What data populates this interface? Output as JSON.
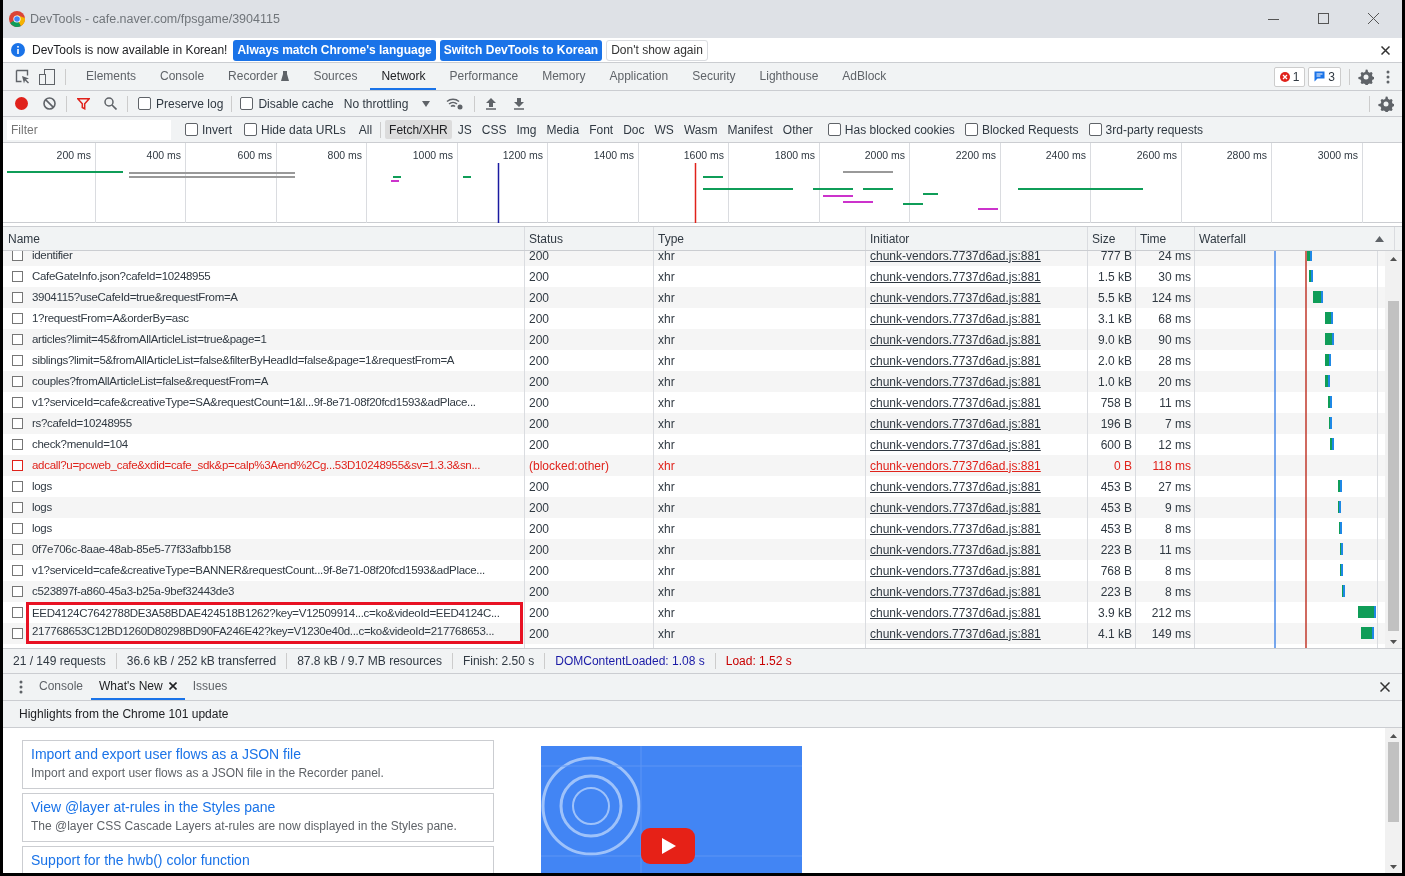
{
  "window": {
    "title": "DevTools - cafe.naver.com/fpsgame/3904115"
  },
  "infobar": {
    "message": "DevTools is now available in Korean!",
    "buttons": [
      {
        "label": "Always match Chrome's language",
        "kind": "primary"
      },
      {
        "label": "Switch DevTools to Korean",
        "kind": "primary"
      },
      {
        "label": "Don't show again",
        "kind": "secondary"
      }
    ]
  },
  "panel_tabs": [
    {
      "label": "Elements",
      "selected": false
    },
    {
      "label": "Console",
      "selected": false
    },
    {
      "label": "Recorder",
      "selected": false,
      "experimental": true
    },
    {
      "label": "Sources",
      "selected": false
    },
    {
      "label": "Network",
      "selected": true
    },
    {
      "label": "Performance",
      "selected": false
    },
    {
      "label": "Memory",
      "selected": false
    },
    {
      "label": "Application",
      "selected": false
    },
    {
      "label": "Security",
      "selected": false
    },
    {
      "label": "Lighthouse",
      "selected": false
    },
    {
      "label": "AdBlock",
      "selected": false
    }
  ],
  "counters": {
    "errors": "1",
    "messages": "3"
  },
  "toolbar": {
    "recording": true,
    "preserve_log": false,
    "disable_cache": false,
    "throttling": "No throttling",
    "preserve_log_label": "Preserve log",
    "disable_cache_label": "Disable cache"
  },
  "filter": {
    "placeholder": "Filter",
    "options": [
      {
        "label": "Invert",
        "checked": false
      },
      {
        "label": "Hide data URLs",
        "checked": false
      }
    ],
    "types": [
      {
        "label": "All",
        "selected": false
      },
      {
        "label": "Fetch/XHR",
        "selected": true
      },
      {
        "label": "JS",
        "selected": false
      },
      {
        "label": "CSS",
        "selected": false
      },
      {
        "label": "Img",
        "selected": false
      },
      {
        "label": "Media",
        "selected": false
      },
      {
        "label": "Font",
        "selected": false
      },
      {
        "label": "Doc",
        "selected": false
      },
      {
        "label": "WS",
        "selected": false
      },
      {
        "label": "Wasm",
        "selected": false
      },
      {
        "label": "Manifest",
        "selected": false
      },
      {
        "label": "Other",
        "selected": false
      }
    ],
    "extra": [
      {
        "label": "Has blocked cookies",
        "checked": false
      },
      {
        "label": "Blocked Requests",
        "checked": false
      },
      {
        "label": "3rd-party requests",
        "checked": false
      }
    ]
  },
  "overview": {
    "ticks": [
      "200 ms",
      "400 ms",
      "600 ms",
      "800 ms",
      "1000 ms",
      "1200 ms",
      "1400 ms",
      "1600 ms",
      "1800 ms",
      "2000 ms",
      "2200 ms",
      "2400 ms",
      "2600 ms",
      "2800 ms",
      "3000 ms"
    ]
  },
  "table": {
    "columns": [
      "Name",
      "Status",
      "Type",
      "Initiator",
      "Size",
      "Time",
      "Waterfall"
    ],
    "rows": [
      {
        "name": "identifier",
        "status": "200",
        "type": "xhr",
        "initiator": "chunk-vendors.7737d6ad.js:881",
        "size": "777 B",
        "time": "24 ms",
        "blocked": false,
        "highlighted": false,
        "checked": false
      },
      {
        "name": "CafeGateInfo.json?cafeId=10248955",
        "status": "200",
        "type": "xhr",
        "initiator": "chunk-vendors.7737d6ad.js:881",
        "size": "1.5 kB",
        "time": "30 ms",
        "blocked": false,
        "highlighted": false,
        "checked": false
      },
      {
        "name": "3904115?useCafeId=true&requestFrom=A",
        "status": "200",
        "type": "xhr",
        "initiator": "chunk-vendors.7737d6ad.js:881",
        "size": "5.5 kB",
        "time": "124 ms",
        "blocked": false,
        "highlighted": false,
        "checked": false
      },
      {
        "name": "1?requestFrom=A&orderBy=asc",
        "status": "200",
        "type": "xhr",
        "initiator": "chunk-vendors.7737d6ad.js:881",
        "size": "3.1 kB",
        "time": "68 ms",
        "blocked": false,
        "highlighted": false,
        "checked": false
      },
      {
        "name": "articles?limit=45&fromAllArticleList=true&page=1",
        "status": "200",
        "type": "xhr",
        "initiator": "chunk-vendors.7737d6ad.js:881",
        "size": "9.0 kB",
        "time": "90 ms",
        "blocked": false,
        "highlighted": false,
        "checked": false
      },
      {
        "name": "siblings?limit=5&fromAllArticleList=false&filterByHeadId=false&page=1&requestFrom=A",
        "status": "200",
        "type": "xhr",
        "initiator": "chunk-vendors.7737d6ad.js:881",
        "size": "2.0 kB",
        "time": "28 ms",
        "blocked": false,
        "highlighted": false,
        "checked": false
      },
      {
        "name": "couples?fromAllArticleList=false&requestFrom=A",
        "status": "200",
        "type": "xhr",
        "initiator": "chunk-vendors.7737d6ad.js:881",
        "size": "1.0 kB",
        "time": "20 ms",
        "blocked": false,
        "highlighted": false,
        "checked": false
      },
      {
        "name": "v1?serviceId=cafe&creativeType=SA&requestCount=1&l...9f-8e71-08f20fcd1593&adPlace...",
        "status": "200",
        "type": "xhr",
        "initiator": "chunk-vendors.7737d6ad.js:881",
        "size": "758 B",
        "time": "11 ms",
        "blocked": false,
        "highlighted": false,
        "checked": false
      },
      {
        "name": "rs?cafeId=10248955",
        "status": "200",
        "type": "xhr",
        "initiator": "chunk-vendors.7737d6ad.js:881",
        "size": "196 B",
        "time": "7 ms",
        "blocked": false,
        "highlighted": false,
        "checked": false
      },
      {
        "name": "check?menuId=104",
        "status": "200",
        "type": "xhr",
        "initiator": "chunk-vendors.7737d6ad.js:881",
        "size": "600 B",
        "time": "12 ms",
        "blocked": false,
        "highlighted": false,
        "checked": false
      },
      {
        "name": "adcall?u=pcweb_cafe&xdid=cafe_sdk&p=calp%3Aend%2Cg...53D10248955&sv=1.3.3&sn...",
        "status": "(blocked:other)",
        "type": "xhr",
        "initiator": "chunk-vendors.7737d6ad.js:881",
        "size": "0 B",
        "time": "118 ms",
        "blocked": true,
        "highlighted": false,
        "checked": false
      },
      {
        "name": "logs",
        "status": "200",
        "type": "xhr",
        "initiator": "chunk-vendors.7737d6ad.js:881",
        "size": "453 B",
        "time": "27 ms",
        "blocked": false,
        "highlighted": false,
        "checked": false
      },
      {
        "name": "logs",
        "status": "200",
        "type": "xhr",
        "initiator": "chunk-vendors.7737d6ad.js:881",
        "size": "453 B",
        "time": "9 ms",
        "blocked": false,
        "highlighted": false,
        "checked": false
      },
      {
        "name": "logs",
        "status": "200",
        "type": "xhr",
        "initiator": "chunk-vendors.7737d6ad.js:881",
        "size": "453 B",
        "time": "8 ms",
        "blocked": false,
        "highlighted": false,
        "checked": false
      },
      {
        "name": "0f7e706c-8aae-48ab-85e5-77f33afbb158",
        "status": "200",
        "type": "xhr",
        "initiator": "chunk-vendors.7737d6ad.js:881",
        "size": "223 B",
        "time": "11 ms",
        "blocked": false,
        "highlighted": false,
        "checked": false
      },
      {
        "name": "v1?serviceId=cafe&creativeType=BANNER&requestCount...9f-8e71-08f20fcd1593&adPlace...",
        "status": "200",
        "type": "xhr",
        "initiator": "chunk-vendors.7737d6ad.js:881",
        "size": "768 B",
        "time": "8 ms",
        "blocked": false,
        "highlighted": false,
        "checked": false
      },
      {
        "name": "c523897f-a860-45a3-b25a-9bef32443de3",
        "status": "200",
        "type": "xhr",
        "initiator": "chunk-vendors.7737d6ad.js:881",
        "size": "223 B",
        "time": "8 ms",
        "blocked": false,
        "highlighted": false,
        "checked": false
      },
      {
        "name": "EED4124C7642788DE3A58BDAE424518B1262?key=V12509914...c=ko&videoId=EED4124C...",
        "status": "200",
        "type": "xhr",
        "initiator": "chunk-vendors.7737d6ad.js:881",
        "size": "3.9 kB",
        "time": "212 ms",
        "blocked": false,
        "highlighted": true,
        "checked": false
      },
      {
        "name": "217768653C12BD1260D80298BD90FA246E42?key=V1230e40d...c=ko&videoId=217768653...",
        "status": "200",
        "type": "xhr",
        "initiator": "chunk-vendors.7737d6ad.js:881",
        "size": "4.1 kB",
        "time": "149 ms",
        "blocked": false,
        "highlighted": true,
        "checked": false
      }
    ]
  },
  "summary": [
    {
      "text": "21 / 149 requests",
      "kind": "plain"
    },
    {
      "text": "36.6 kB / 252 kB transferred",
      "kind": "plain"
    },
    {
      "text": "87.8 kB / 9.7 MB resources",
      "kind": "plain"
    },
    {
      "text": "Finish: 2.50 s",
      "kind": "plain"
    },
    {
      "text": "DOMContentLoaded: 1.08 s",
      "kind": "dom"
    },
    {
      "text": "Load: 1.52 s",
      "kind": "load"
    }
  ],
  "drawer": {
    "tabs": [
      {
        "label": "Console",
        "selected": false,
        "closable": false
      },
      {
        "label": "What's New",
        "selected": true,
        "closable": true
      },
      {
        "label": "Issues",
        "selected": false,
        "closable": false
      }
    ],
    "heading": "Highlights from the Chrome 101 update",
    "cards": [
      {
        "title": "Import and export user flows as a JSON file",
        "description": "Import and export user flows as a JSON file in the Recorder panel."
      },
      {
        "title": "View @layer at-rules in the Styles pane",
        "description": "The @layer CSS Cascade Layers at-rules are now displayed in the Styles pane."
      },
      {
        "title": "Support for the hwb() color function"
      }
    ]
  }
}
